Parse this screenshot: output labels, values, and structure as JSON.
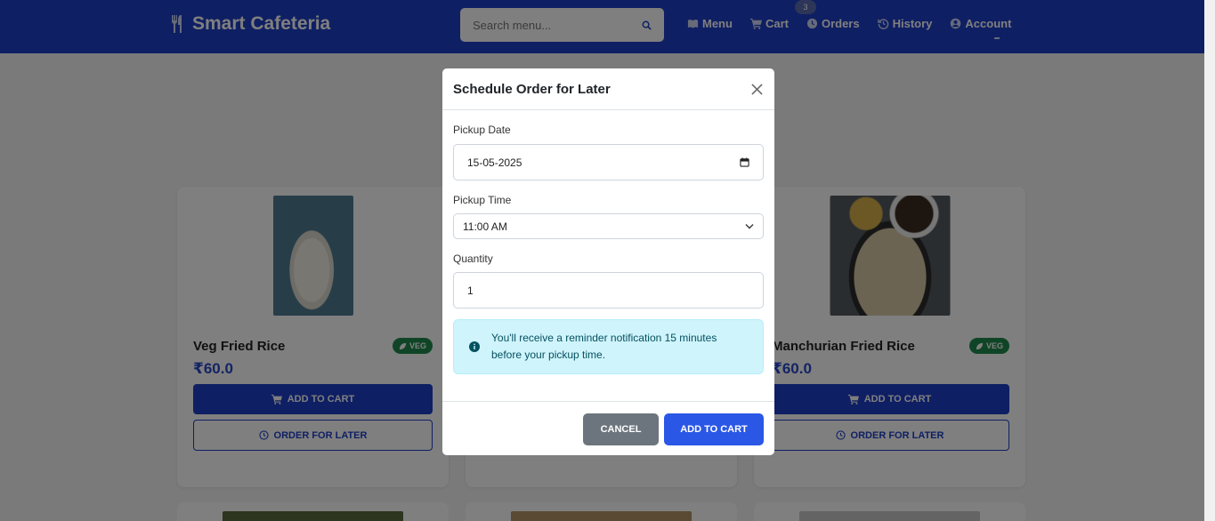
{
  "navbar": {
    "brand": "Smart Cafeteria",
    "search_placeholder": "Search menu...",
    "links": [
      {
        "label": "Menu",
        "icon": "book-icon"
      },
      {
        "label": "Cart",
        "icon": "cart-icon"
      },
      {
        "label": "Orders",
        "icon": "clock-icon"
      },
      {
        "label": "History",
        "icon": "history-icon"
      },
      {
        "label": "Account",
        "icon": "user-icon"
      }
    ],
    "cart_count": "3"
  },
  "menu_items": [
    {
      "name": "Veg Fried Rice",
      "badge": "VEG",
      "price": "₹60.0",
      "add_label": "ADD TO CART",
      "later_label": "ORDER FOR LATER"
    },
    {
      "name": "Manchurian Fried Rice",
      "badge": "VEG",
      "price": "₹60.0",
      "add_label": "ADD TO CART",
      "later_label": "ORDER FOR LATER"
    }
  ],
  "modal": {
    "title": "Schedule Order for Later",
    "pickup_date_label": "Pickup Date",
    "pickup_date_value": "15-05-2025",
    "pickup_time_label": "Pickup Time",
    "pickup_time_value": "11:00 AM",
    "quantity_label": "Quantity",
    "quantity_value": "1",
    "info_line1": "You'll receive a reminder notification 15 minutes",
    "info_line2": "before your pickup time.",
    "cancel_label": "CANCEL",
    "confirm_label": "ADD TO CART"
  },
  "colors": {
    "brand_blue": "#1f3fc7",
    "accent_blue": "#2b57e6",
    "veg_green": "#1e8a4c",
    "info_bg": "#cff4fc"
  }
}
